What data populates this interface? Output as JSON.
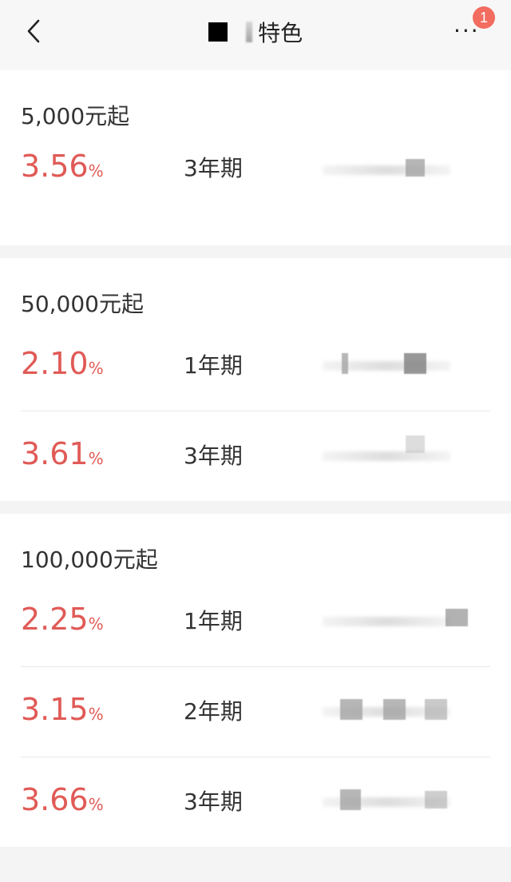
{
  "header": {
    "title": "特色",
    "more": "···",
    "badge": "1"
  },
  "sections": [
    {
      "title": "5,000元起",
      "rows": [
        {
          "rate": "3.56",
          "unit": "%",
          "term": "3年期"
        }
      ]
    },
    {
      "title": "50,000元起",
      "rows": [
        {
          "rate": "2.10",
          "unit": "%",
          "term": "1年期"
        },
        {
          "rate": "3.61",
          "unit": "%",
          "term": "3年期"
        }
      ]
    },
    {
      "title": "100,000元起",
      "rows": [
        {
          "rate": "2.25",
          "unit": "%",
          "term": "1年期"
        },
        {
          "rate": "3.15",
          "unit": "%",
          "term": "2年期"
        },
        {
          "rate": "3.66",
          "unit": "%",
          "term": "3年期"
        }
      ]
    }
  ],
  "colors": {
    "rate": "#e05a56",
    "badge": "#f26c5f",
    "background": "#f4f4f4"
  },
  "icons": {
    "back": "chevron-left-icon",
    "more": "more-icon"
  }
}
